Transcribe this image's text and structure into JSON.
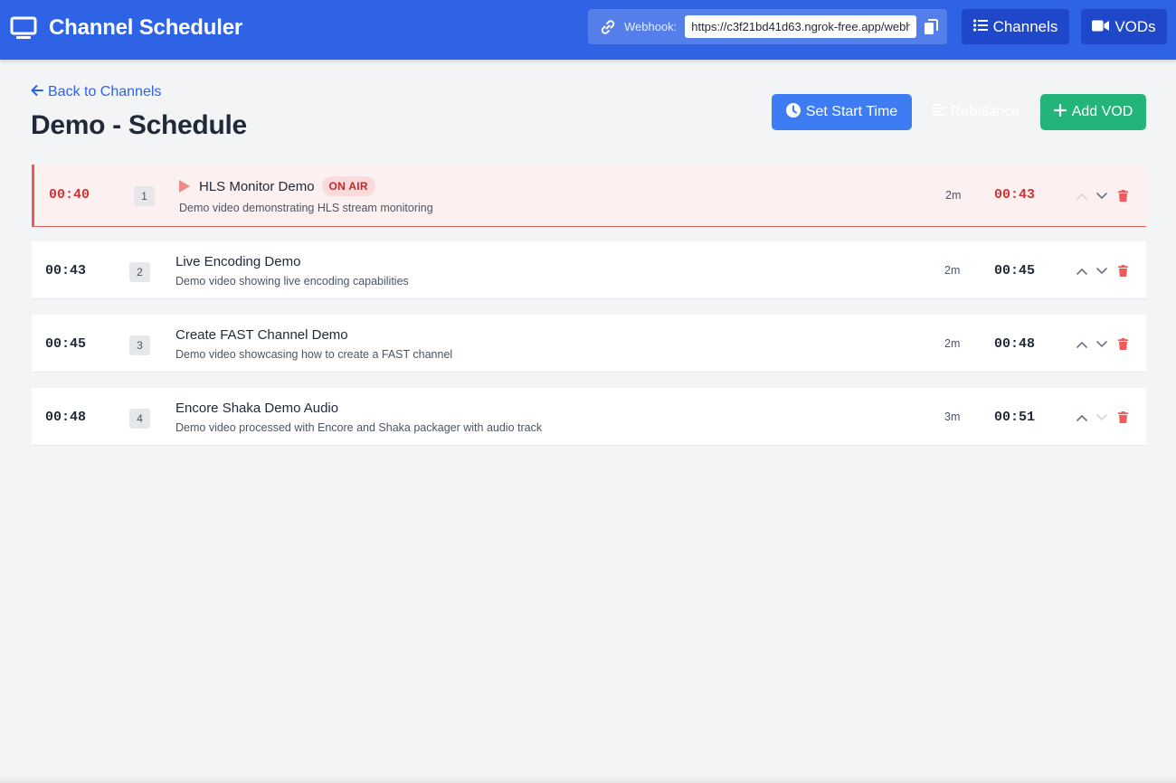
{
  "colors": {
    "header_bg": "#2f63e6",
    "nav_button_bg": "#1f47c9",
    "start_time_button": "#3d7cf2",
    "add_vod_button": "#23b479",
    "on_air_accent": "#e85a5a",
    "on_air_row_bg": "#fdf0f0",
    "delete_icon": "#ef5b5b"
  },
  "header": {
    "app_title": "Channel Scheduler",
    "app_icon": "monitor-icon",
    "webhook_label": "Webhook:",
    "webhook_url": "https://c3f21bd41d63.ngrok-free.app/webh",
    "webhook_icon": "link-icon",
    "copy_icon": "copy-icon",
    "nav": {
      "channels_label": "Channels",
      "channels_icon": "list-icon",
      "vods_label": "VODs",
      "vods_icon": "video-camera-icon"
    }
  },
  "page": {
    "back_link": "Back to Channels",
    "title": "Demo - Schedule",
    "actions": {
      "set_start_time": "Set Start Time",
      "rebalance": "Rebalance",
      "add_vod": "Add VOD"
    }
  },
  "schedule": {
    "items": [
      {
        "start": "00:40",
        "index": "1",
        "title": "HLS Monitor Demo",
        "badge": "ON AIR",
        "description": "Demo video demonstrating HLS stream monitoring",
        "duration": "2m",
        "end": "00:43",
        "on_air": true,
        "up_enabled": false,
        "down_enabled": true
      },
      {
        "start": "00:43",
        "index": "2",
        "title": "Live Encoding Demo",
        "description": "Demo video showing live encoding capabilities",
        "duration": "2m",
        "end": "00:45",
        "on_air": false,
        "up_enabled": true,
        "down_enabled": true
      },
      {
        "start": "00:45",
        "index": "3",
        "title": "Create FAST Channel Demo",
        "description": "Demo video showcasing how to create a FAST channel",
        "duration": "2m",
        "end": "00:48",
        "on_air": false,
        "up_enabled": true,
        "down_enabled": true
      },
      {
        "start": "00:48",
        "index": "4",
        "title": "Encore Shaka Demo Audio",
        "description": "Demo video processed with Encore and Shaka packager with audio track",
        "duration": "3m",
        "end": "00:51",
        "on_air": false,
        "up_enabled": true,
        "down_enabled": false
      }
    ]
  }
}
